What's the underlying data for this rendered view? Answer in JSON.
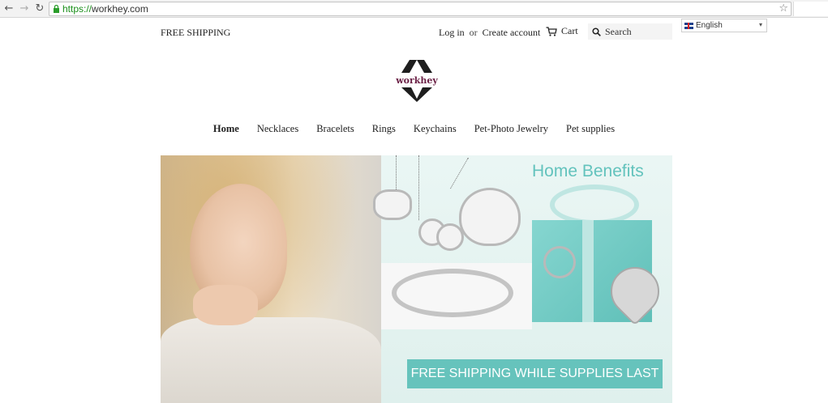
{
  "browser": {
    "url_scheme": "https://",
    "url_host": "workhey.com",
    "icons": [
      "back-icon",
      "forward-icon",
      "reload-icon",
      "lock-icon",
      "star-icon"
    ]
  },
  "topbar": {
    "free_shipping": "FREE SHIPPING",
    "login": "Log in",
    "or": "or",
    "create_account": "Create account",
    "cart": "Cart",
    "search_placeholder": "Search"
  },
  "language": {
    "selected": "English"
  },
  "logo": {
    "text": "workhey"
  },
  "nav": {
    "items": [
      {
        "label": "Home",
        "active": true
      },
      {
        "label": "Necklaces"
      },
      {
        "label": "Bracelets"
      },
      {
        "label": "Rings"
      },
      {
        "label": "Keychains"
      },
      {
        "label": "Pet-Photo Jewelry"
      },
      {
        "label": "Pet supplies"
      }
    ]
  },
  "hero": {
    "title": "Home Benefits",
    "cta": "FREE SHIPPING WHILE SUPPLIES LAST"
  },
  "colors": {
    "accent_teal": "#66c3bc",
    "logo_purple": "#6b2146",
    "url_green": "#1a8f1a"
  }
}
